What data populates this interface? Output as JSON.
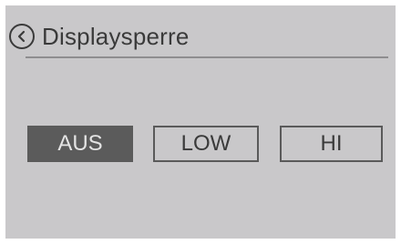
{
  "header": {
    "back_icon": "chevron-left-circle-icon",
    "title": "Displaysperre"
  },
  "options": {
    "items": [
      {
        "label": "AUS",
        "selected": true
      },
      {
        "label": "LOW",
        "selected": false
      },
      {
        "label": "HI",
        "selected": false
      }
    ]
  },
  "colors": {
    "background": "#c9c8ca",
    "text": "#3a3a3a",
    "selected_fill": "#5b5b5b",
    "selected_text": "#e4e4e4",
    "divider": "#8e8d8f"
  }
}
